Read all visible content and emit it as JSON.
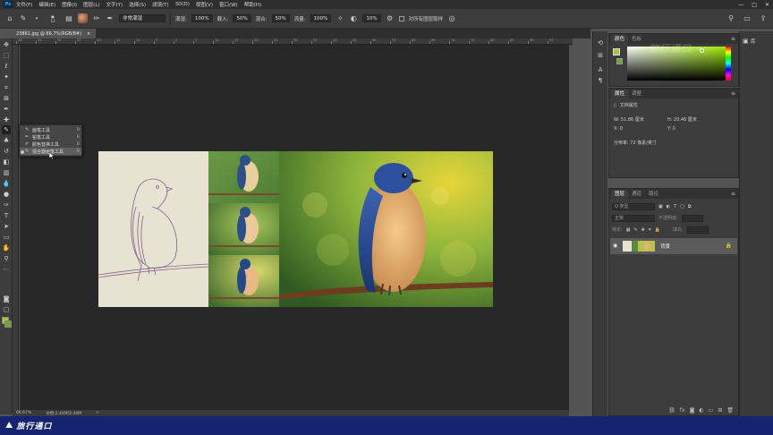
{
  "app": {
    "logo": "Ps",
    "menu": [
      "文件(F)",
      "编辑(E)",
      "图像(I)",
      "图层(L)",
      "文字(Y)",
      "选择(S)",
      "滤镜(T)",
      "3D(D)",
      "视图(V)",
      "窗口(W)",
      "帮助(H)"
    ],
    "window_controls": [
      "—",
      "□",
      "✕"
    ]
  },
  "options": {
    "brush_size": "13",
    "blend_mode": "非常潮湿",
    "wet_label": "潮湿:",
    "wet_value": "100%",
    "load_label": "载入:",
    "load_value": "50%",
    "mix_label": "混合:",
    "mix_value": "50%",
    "flow_label": "流量:",
    "flow_value": "100%",
    "smooth_value": "10%",
    "sample_all_label": "对所有图层取样"
  },
  "document": {
    "tab_title": "23861.jpg @ 66.7%(RGB/8#)",
    "close": "×"
  },
  "ruler": {
    "labels": [
      "40",
      "35",
      "30",
      "25",
      "20",
      "15",
      "10",
      "5",
      "0",
      "5",
      "10",
      "15",
      "20",
      "25",
      "30",
      "35",
      "40",
      "45",
      "50",
      "55",
      "60",
      "65",
      "70",
      "75",
      "80",
      "85",
      "90",
      "95"
    ]
  },
  "flyout": {
    "items": [
      {
        "label": "画笔工具",
        "key": "B",
        "selected": false
      },
      {
        "label": "铅笔工具",
        "key": "B",
        "selected": false
      },
      {
        "label": "颜色替换工具",
        "key": "B",
        "selected": false
      },
      {
        "label": "混合器画笔工具",
        "key": "B",
        "selected": true
      }
    ]
  },
  "status": {
    "zoom": "66.67%",
    "doc_size": "文档:2.44M/2.44M",
    "arrow": ">"
  },
  "color_panel": {
    "tabs": [
      "颜色",
      "色板"
    ],
    "foreground": "#a6c63b",
    "background": "#73a52c"
  },
  "properties_panel": {
    "tabs": [
      "属性",
      "调整"
    ],
    "section": "文档属性",
    "w": "W:  51.86 厘米",
    "h": "H:  20.46 厘米",
    "x": "X:  0",
    "y": "Y:  0",
    "resolution": "分辨率: 72 像素/英寸"
  },
  "layers_panel": {
    "tabs": [
      "图层",
      "通道",
      "路径"
    ],
    "filter_label": "Q 类型",
    "blend_mode": "正常",
    "opacity_label": "不透明度:",
    "lock_label": "锁定:",
    "fill_label": "填充:",
    "layer_name": "背景"
  },
  "right_strip": {
    "library_label": "库"
  },
  "watermark": {
    "text": "旅行通口",
    "top_text": "旅行通口"
  }
}
